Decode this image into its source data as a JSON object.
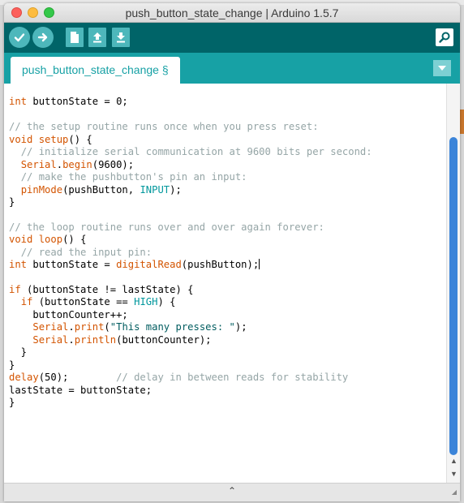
{
  "window": {
    "title": "push_button_state_change | Arduino 1.5.7"
  },
  "toolbar": {
    "verify_icon": "checkmark-icon",
    "upload_icon": "right-arrow-icon",
    "new_icon": "new-file-icon",
    "open_icon": "open-up-arrow-icon",
    "save_icon": "save-down-arrow-icon",
    "serial_monitor_icon": "magnifier-icon"
  },
  "tab": {
    "label": "push_button_state_change §",
    "menu_icon": "triangle-down-icon"
  },
  "code_lines": [
    "int buttonState = 0;",
    "",
    "// the setup routine runs once when you press reset:",
    "void setup() {",
    "  // initialize serial communication at 9600 bits per second:",
    "  Serial.begin(9600);",
    "  // make the pushbutton's pin an input:",
    "  pinMode(pushButton, INPUT);",
    "}",
    "",
    "// the loop routine runs over and over again forever:",
    "void loop() {",
    "  // read the input pin:",
    "int buttonState = digitalRead(pushButton);",
    "",
    "if (buttonState != lastState) {",
    "  if (buttonState == HIGH) {",
    "    buttonCounter++;",
    "    Serial.print(\"This many presses: \");",
    "    Serial.println(buttonCounter);",
    "  }",
    "}",
    "delay(50);        // delay in between reads for stability",
    "lastState = buttonState;",
    "}"
  ],
  "colors": {
    "toolbar": "#006468",
    "tabbar": "#17a1a5",
    "keyword": "#d35400",
    "comment": "#95a5a6",
    "constant": "#00979c",
    "scroll_thumb": "#3b84d9"
  }
}
